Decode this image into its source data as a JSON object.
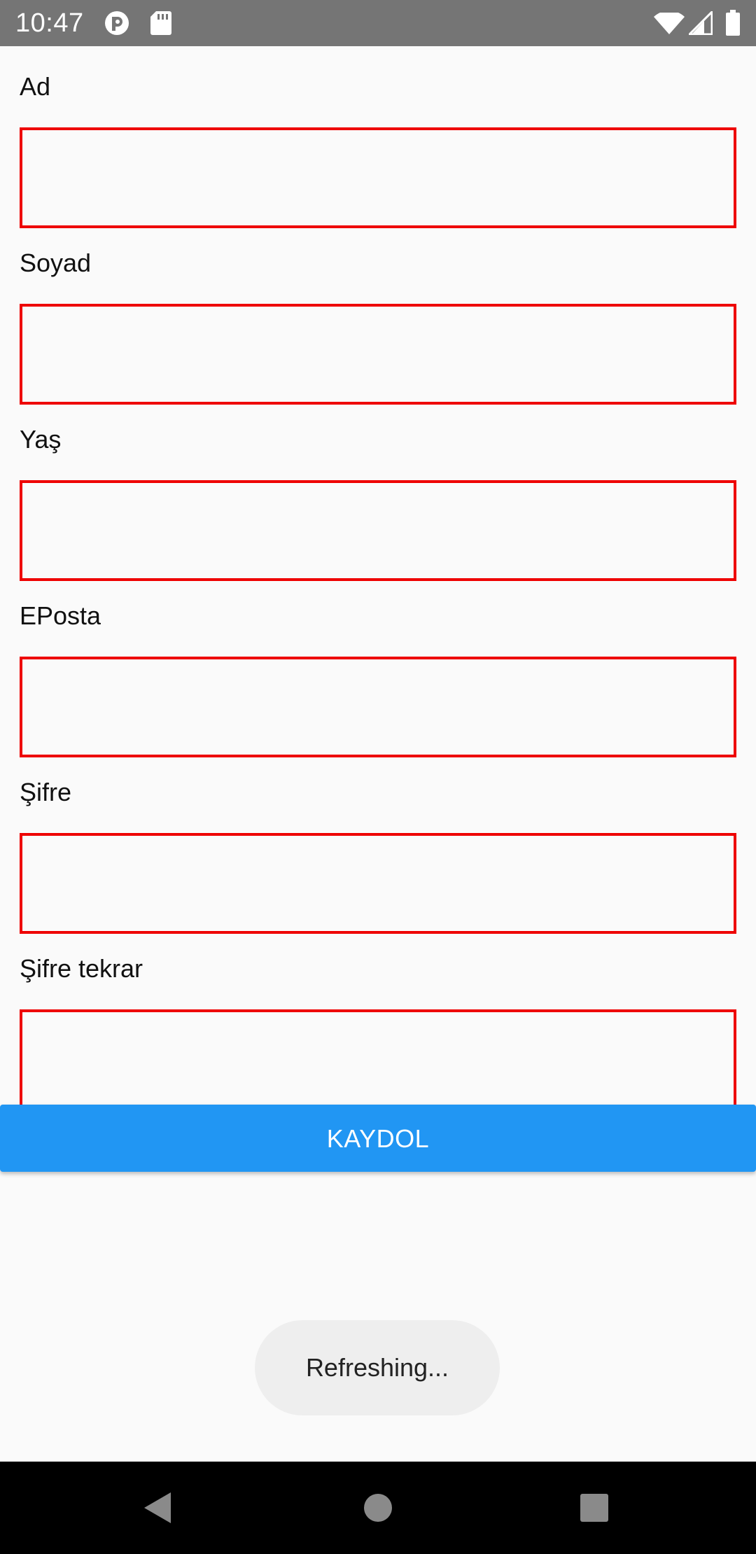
{
  "status_bar": {
    "time": "10:47",
    "icons": [
      "app-notification-icon",
      "sd-card-icon",
      "wifi-icon",
      "cell-signal-icon",
      "battery-icon"
    ]
  },
  "form": {
    "fields": [
      {
        "label": "Ad",
        "value": "",
        "placeholder": ""
      },
      {
        "label": "Soyad",
        "value": "",
        "placeholder": ""
      },
      {
        "label": "Yaş",
        "value": "",
        "placeholder": ""
      },
      {
        "label": "EPosta",
        "value": "",
        "placeholder": ""
      },
      {
        "label": "Şifre",
        "value": "",
        "placeholder": ""
      },
      {
        "label": "Şifre tekrar",
        "value": "",
        "placeholder": ""
      }
    ],
    "submit_label": "KAYDOL"
  },
  "toast": {
    "text": "Refreshing..."
  },
  "nav_bar": {
    "icons": [
      "back-icon",
      "home-icon",
      "recents-icon"
    ]
  },
  "colors": {
    "status_bar": "#757575",
    "input_border": "#ee0000",
    "button": "#2196f3",
    "toast_bg": "#eeeeee",
    "nav_bar": "#000000"
  }
}
